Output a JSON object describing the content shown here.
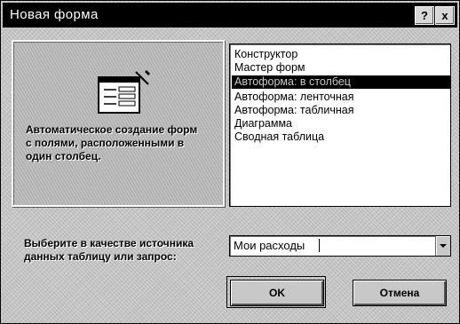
{
  "window": {
    "title": "Новая форма"
  },
  "titlebar": {
    "help_glyph": "?",
    "close_glyph": "x"
  },
  "preview": {
    "description": "Автоматическое создание форм с полями, расположенными в один столбец."
  },
  "form_types": {
    "items": [
      {
        "label": "Конструктор",
        "selected": false
      },
      {
        "label": "Мастер форм",
        "selected": false
      },
      {
        "label": "Автоформа: в столбец",
        "selected": true
      },
      {
        "label": "Автоформа: ленточная",
        "selected": false
      },
      {
        "label": "Автоформа: табличная",
        "selected": false
      },
      {
        "label": "Диаграмма",
        "selected": false
      },
      {
        "label": "Сводная таблица",
        "selected": false
      }
    ]
  },
  "source": {
    "label": "Выберите в качестве источника данных таблицу или запрос:",
    "value": "Мои расходы"
  },
  "buttons": {
    "ok": "OK",
    "cancel": "Отмена"
  },
  "icons": {
    "help": "help-icon",
    "close": "close-icon",
    "form_preview": "form-icon",
    "dropdown": "chevron-down-icon"
  }
}
